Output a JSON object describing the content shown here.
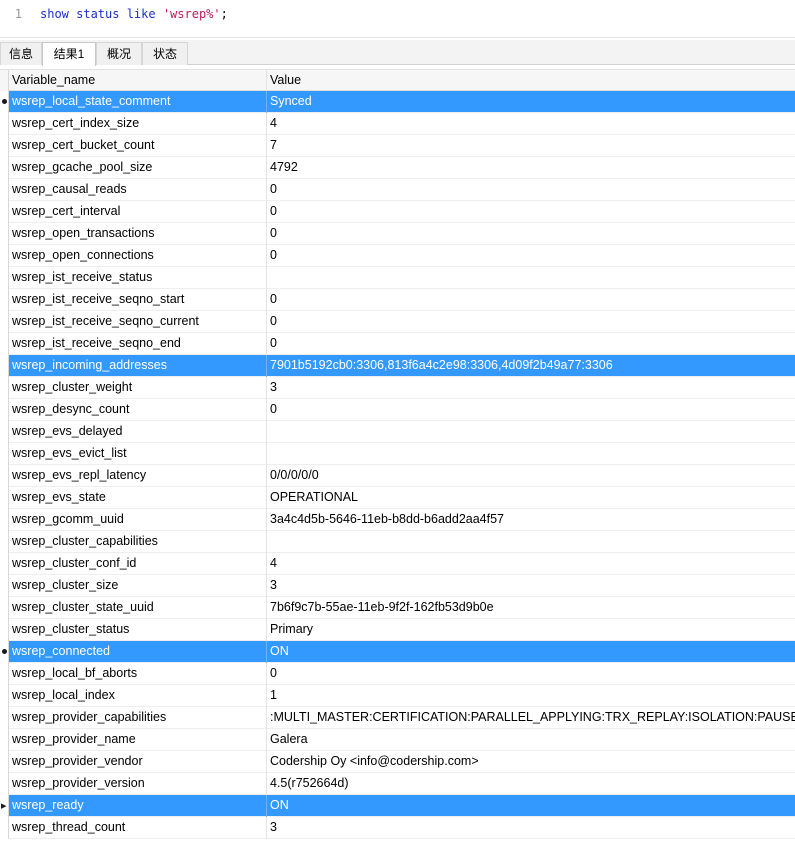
{
  "editor": {
    "line_number": "1",
    "code_keyword_1": "show status like",
    "code_string": "'wsrep%'",
    "code_end": ";"
  },
  "tabs": [
    "信息",
    "结果1",
    "概况",
    "状态"
  ],
  "active_tab": "结果1",
  "table": {
    "columns": [
      "Variable_name",
      "Value"
    ],
    "rows": [
      {
        "name": "wsrep_local_state_comment",
        "value": "Synced",
        "selected": true,
        "marker": "dot"
      },
      {
        "name": "wsrep_cert_index_size",
        "value": "4"
      },
      {
        "name": "wsrep_cert_bucket_count",
        "value": "7"
      },
      {
        "name": "wsrep_gcache_pool_size",
        "value": "4792"
      },
      {
        "name": "wsrep_causal_reads",
        "value": "0"
      },
      {
        "name": "wsrep_cert_interval",
        "value": "0"
      },
      {
        "name": "wsrep_open_transactions",
        "value": "0"
      },
      {
        "name": "wsrep_open_connections",
        "value": "0"
      },
      {
        "name": "wsrep_ist_receive_status",
        "value": ""
      },
      {
        "name": "wsrep_ist_receive_seqno_start",
        "value": "0"
      },
      {
        "name": "wsrep_ist_receive_seqno_current",
        "value": "0"
      },
      {
        "name": "wsrep_ist_receive_seqno_end",
        "value": "0"
      },
      {
        "name": "wsrep_incoming_addresses",
        "value": "7901b5192cb0:3306,813f6a4c2e98:3306,4d09f2b49a77:3306",
        "selected": true
      },
      {
        "name": "wsrep_cluster_weight",
        "value": "3"
      },
      {
        "name": "wsrep_desync_count",
        "value": "0"
      },
      {
        "name": "wsrep_evs_delayed",
        "value": ""
      },
      {
        "name": "wsrep_evs_evict_list",
        "value": ""
      },
      {
        "name": "wsrep_evs_repl_latency",
        "value": "0/0/0/0/0"
      },
      {
        "name": "wsrep_evs_state",
        "value": "OPERATIONAL"
      },
      {
        "name": "wsrep_gcomm_uuid",
        "value": "3a4c4d5b-5646-11eb-b8dd-b6add2aa4f57"
      },
      {
        "name": "wsrep_cluster_capabilities",
        "value": ""
      },
      {
        "name": "wsrep_cluster_conf_id",
        "value": "4"
      },
      {
        "name": "wsrep_cluster_size",
        "value": "3"
      },
      {
        "name": "wsrep_cluster_state_uuid",
        "value": "7b6f9c7b-55ae-11eb-9f2f-162fb53d9b0e"
      },
      {
        "name": "wsrep_cluster_status",
        "value": "Primary"
      },
      {
        "name": "wsrep_connected",
        "value": "ON",
        "selected": true,
        "marker": "dot"
      },
      {
        "name": "wsrep_local_bf_aborts",
        "value": "0"
      },
      {
        "name": "wsrep_local_index",
        "value": "1"
      },
      {
        "name": "wsrep_provider_capabilities",
        "value": ":MULTI_MASTER:CERTIFICATION:PARALLEL_APPLYING:TRX_REPLAY:ISOLATION:PAUSE:CAUSAL_READS:INCREMENTAL_WRITESET:UNORDERED:PREORDERED:STREAMING:NBO:"
      },
      {
        "name": "wsrep_provider_name",
        "value": "Galera"
      },
      {
        "name": "wsrep_provider_vendor",
        "value": "Codership Oy <info@codership.com>"
      },
      {
        "name": "wsrep_provider_version",
        "value": "4.5(r752664d)"
      },
      {
        "name": "wsrep_ready",
        "value": "ON",
        "selected": true,
        "marker": "arrow"
      },
      {
        "name": "wsrep_thread_count",
        "value": "3"
      }
    ]
  },
  "colors": {
    "selection": "#3399ff",
    "keyword": "#1b2ed0",
    "string": "#c2185b"
  }
}
